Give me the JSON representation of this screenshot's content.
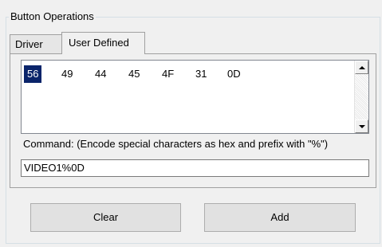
{
  "group": {
    "title": "Button Operations"
  },
  "tabs": [
    {
      "label": "Driver",
      "selected": false
    },
    {
      "label": "User Defined",
      "selected": true
    }
  ],
  "hex_bytes": [
    "56",
    "49",
    "44",
    "45",
    "4F",
    "31",
    "0D"
  ],
  "selected_index": 0,
  "command": {
    "label": "Command:  (Encode special characters as hex and prefix with \"%\")",
    "value": "VIDEO1%0D"
  },
  "buttons": {
    "clear_label": "Clear",
    "add_label": "Add"
  },
  "colors": {
    "selection_bg": "#0a246a",
    "selection_fg": "#ffffff",
    "window_bg": "#f0f0f0"
  }
}
